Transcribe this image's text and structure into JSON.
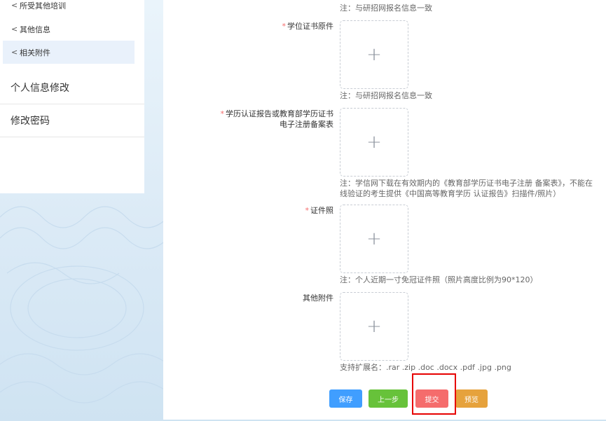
{
  "sidebar": {
    "sub_items": [
      {
        "label": "所受其他培训",
        "chevron": "<"
      },
      {
        "label": "其他信息",
        "chevron": "<"
      },
      {
        "label": "相关附件",
        "chevron": "<"
      }
    ],
    "main_items": [
      {
        "label": "个人信息修改"
      },
      {
        "label": "修改密码"
      }
    ]
  },
  "form": {
    "top_note": "注：与研招网报名信息一致",
    "fields": [
      {
        "label": "学位证书原件",
        "required": "*",
        "note": "注：与研招网报名信息一致"
      },
      {
        "label_line1": "学历认证报告或教育部学历证书",
        "label_line2": "电子注册备案表",
        "required": "*",
        "note_line1": "注：学信网下载在有效期内的《教育部学历证书电子注册 备案表》，不能在",
        "note_line2": "线验证的考生提供《中国高等教育学历 认证报告》扫描件/照片）"
      },
      {
        "label": "证件照",
        "required": "*",
        "note": "注：个人近期一寸免冠证件照（照片高度比例为90*120）"
      },
      {
        "label": "其他附件",
        "note": "支持扩展名：.rar .zip .doc .docx .pdf .jpg .png"
      }
    ],
    "upload_icon": "plus-icon",
    "upload_glyph": "+"
  },
  "buttons": {
    "save": "保存",
    "prev": "上一步",
    "submit": "提交",
    "preview": "预览"
  },
  "colors": {
    "save": "#409eff",
    "prev": "#67c23a",
    "submit": "#f56c6c",
    "preview": "#e6a23c",
    "highlight": "#e60000",
    "required": "#f56c6c"
  }
}
